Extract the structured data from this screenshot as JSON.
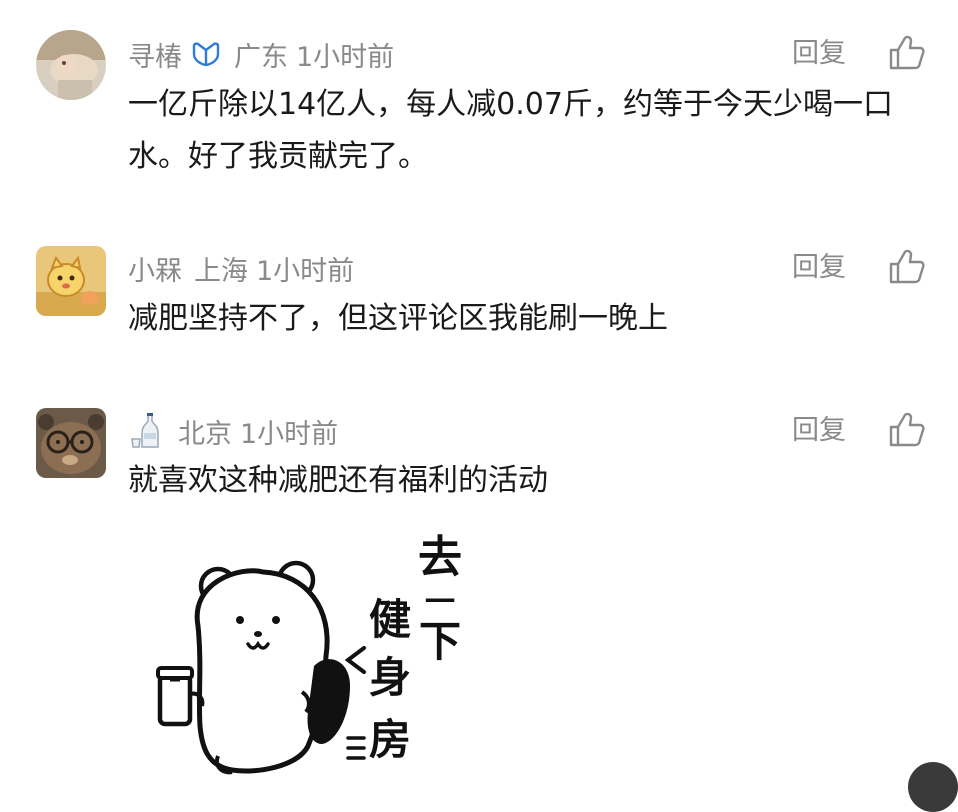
{
  "comments": [
    {
      "username": "寻椿",
      "badge_icon": "verified-v-icon",
      "location": "广东",
      "time": "1小时前",
      "reply_label": "回复",
      "text": "一亿斤除以14亿人，每人减0.07斤，约等于今天少喝一口水。好了我贡献完了。"
    },
    {
      "username": "小槑",
      "location": "上海",
      "time": "1小时前",
      "reply_label": "回复",
      "text": "减肥坚持不了，但这评论区我能刷一晚上"
    },
    {
      "username_icon": "sake-bottle-icon",
      "location": "北京",
      "time": "1小时前",
      "reply_label": "回复",
      "text": "就喜欢这种减肥还有福利的活动",
      "sticker": {
        "text_lines": [
          "去",
          "一",
          "下",
          "健",
          "身",
          "房"
        ]
      }
    }
  ],
  "colors": {
    "meta_gray": "#8a8a8a",
    "text_black": "#1a1a1a",
    "badge_blue": "#2f7bdc"
  }
}
